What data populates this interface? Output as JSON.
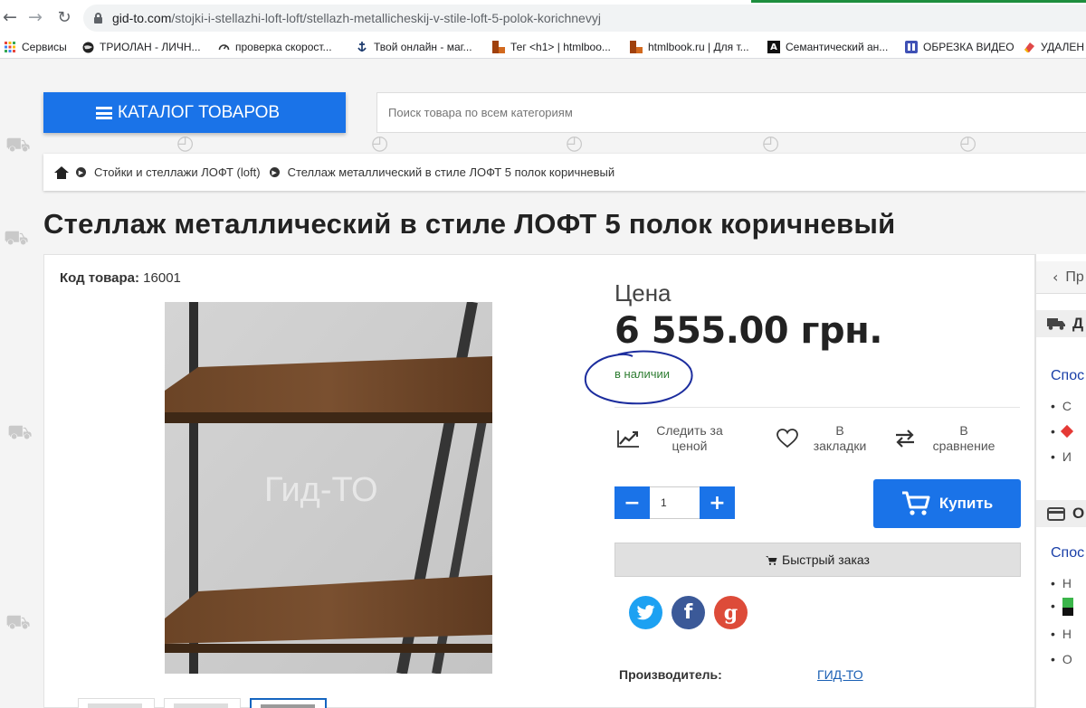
{
  "browser": {
    "url_host": "gid-to.com",
    "url_path": "/stojki-i-stellazhi-loft-loft/stellazh-metallicheskij-v-stile-loft-5-polok-korichnevyj",
    "bookmarks": [
      {
        "label": "Сервисы",
        "icon": "apps-grid-icon"
      },
      {
        "label": "ТРИОЛАН - ЛИЧН...",
        "icon": "globe-icon"
      },
      {
        "label": "проверка скорост...",
        "icon": "speedometer-icon"
      },
      {
        "label": "Твой онлайн - маг...",
        "icon": "anchor-icon"
      },
      {
        "label": "Тег <h1> | htmlboo...",
        "icon": "htmlbook-icon"
      },
      {
        "label": "htmlbook.ru | Для т...",
        "icon": "htmlbook-icon"
      },
      {
        "label": "Семантический ан...",
        "icon": "letter-a-icon"
      },
      {
        "label": "ОБРЕЗКА ВИДЕО",
        "icon": "video-icon"
      },
      {
        "label": "УДАЛЕН",
        "icon": "eraser-icon"
      }
    ]
  },
  "header": {
    "catalog_label": "КАТАЛОГ ТОВАРОВ",
    "search_placeholder": "Поиск товара по всем категориям"
  },
  "breadcrumb": {
    "items": [
      "Стойки и стеллажи ЛОФТ (loft)",
      "Стеллаж металлический в стиле ЛОФТ 5 полок коричневый"
    ]
  },
  "product": {
    "title": "Стеллаж металлический в стиле ЛОФТ 5 полок коричневый",
    "sku_label": "Код товара:",
    "sku_value": "16001",
    "watermark": "Гид-ТО",
    "price_label": "Цена",
    "price_value": "6 555.00 грн.",
    "stock_status": "в наличии",
    "actions": {
      "price_watch": "Следить за ценой",
      "bookmark": "В закладки",
      "compare": "В сравнение"
    },
    "quantity": "1",
    "qty_minus": "−",
    "qty_plus": "+",
    "buy_label": "Купить",
    "quick_order_label": "Быстрый заказ",
    "manufacturer_label": "Производитель:",
    "manufacturer_value": "ГИД-ТО",
    "share_fb": "f",
    "share_gp": "g"
  },
  "sidebar": {
    "back_label": "Пр",
    "delivery_head": "Д",
    "delivery_link": "Спос",
    "delivery_items": [
      "С",
      "",
      "И"
    ],
    "payment_head": "О",
    "payment_link": "Спос",
    "payment_items": [
      "Н",
      "",
      "Н",
      "О"
    ]
  },
  "colors": {
    "accent": "#1a73e8",
    "stock_green": "#2e7d32",
    "twitter": "#1da1f2",
    "facebook": "#3b5998",
    "google_plus": "#dd4b39"
  }
}
